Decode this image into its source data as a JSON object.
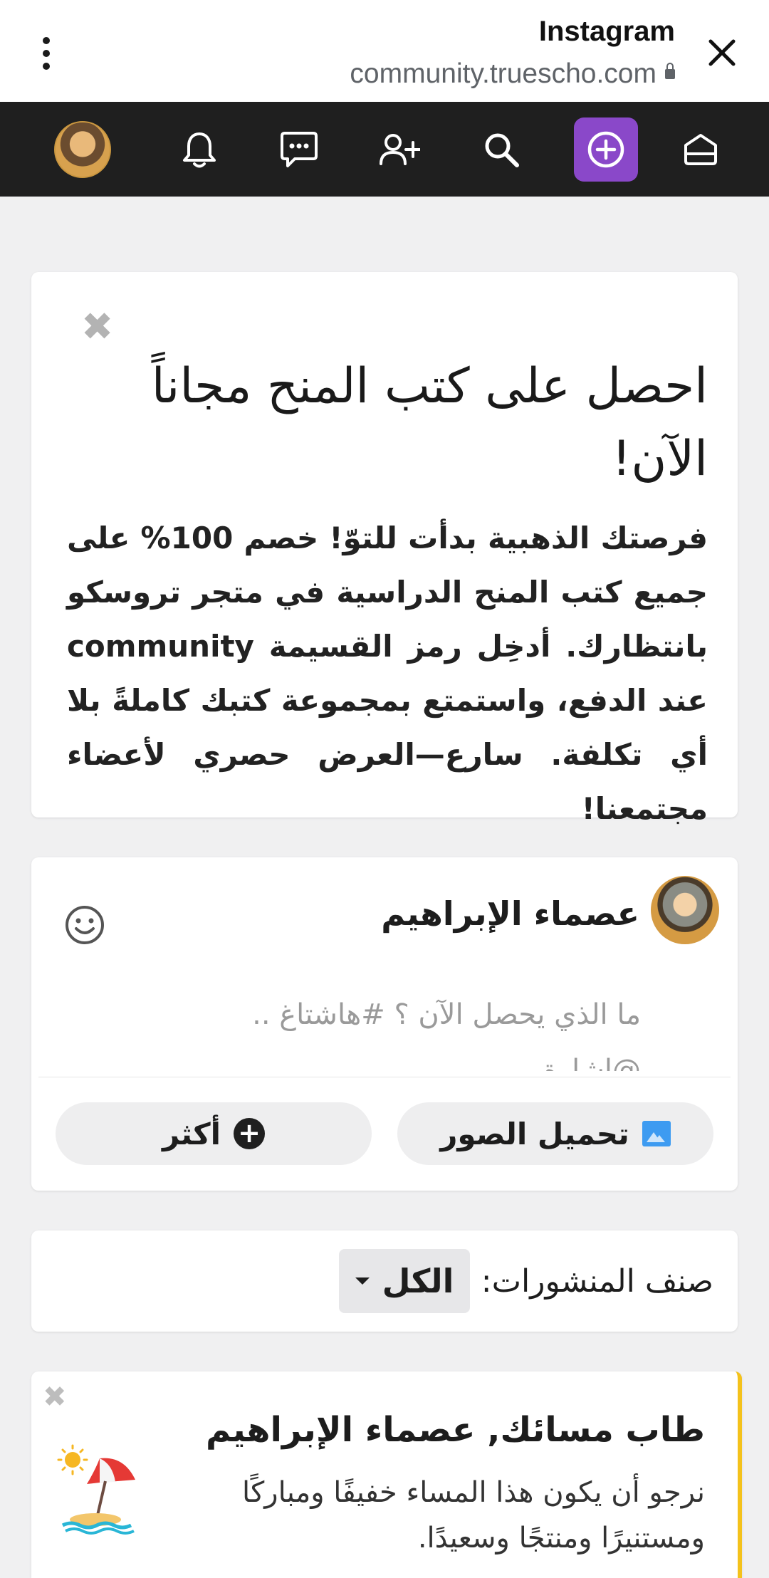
{
  "browser": {
    "title": "Instagram",
    "url": "community.truescho.com",
    "icons": [
      "more-vert-icon",
      "lock-icon",
      "close-icon"
    ]
  },
  "nav": {
    "items": [
      "home-icon",
      "add-post-icon",
      "search-icon",
      "add-friend-icon",
      "messages-icon",
      "notifications-icon",
      "profile-avatar"
    ],
    "accent": "#8a48c9",
    "bg": "#1f1f1f"
  },
  "promo": {
    "title": "احصل على كتب المنح مجاناً الآن!",
    "body": "فرصتك الذهبية بدأت للتوّ! خصم 100% على جميع كتب المنح الدراسية في متجر تروسكو بانتظارك. أدخِل رمز القسيمة community عند الدفع، واستمتع بمجموعة كتبك كاملةً بلا أي تكلفة. سارع—العرض حصري لأعضاء مجتمعنا!",
    "dismiss": "✖"
  },
  "composer": {
    "author": "عصماء الإبراهيم",
    "placeholder": "ما الذي يحصل الآن ؟ #هاشتاغ .. @اشارة",
    "upload_label": "تحميل الصور",
    "more_label": "أكثر",
    "plus_glyph": "+"
  },
  "filter": {
    "label": "صنف المنشورات:",
    "selected": "الكل"
  },
  "greeting": {
    "title": "طاب مسائك, عصماء الإبراهيم",
    "message": "نرجو أن يكون هذا المساء خفيفًا ومباركًا ومستنيرًا ومنتجًا وسعيدًا.",
    "dismiss": "✖",
    "accent": "#f4c21c"
  }
}
